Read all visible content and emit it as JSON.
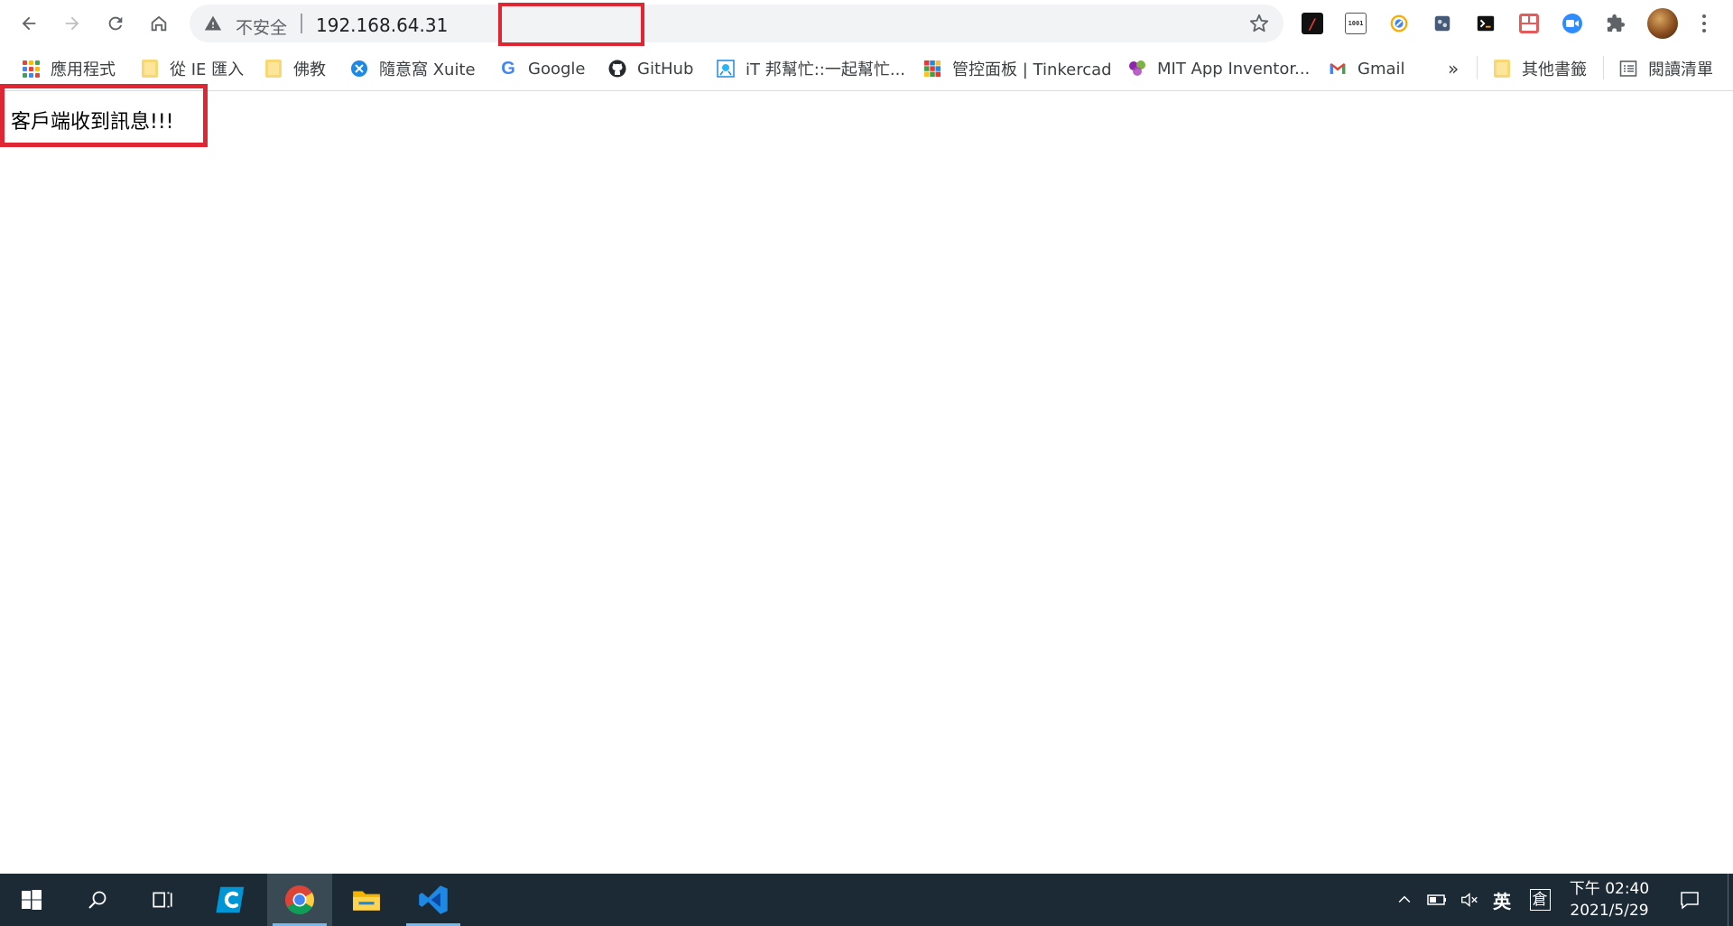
{
  "browser": {
    "address_bar": {
      "security_label": "不安全",
      "url": "192.168.64.31"
    },
    "icons": {
      "back": "arrow-left-icon",
      "forward": "arrow-right-icon",
      "reload": "reload-icon",
      "home": "home-icon",
      "warning": "warning-triangle-icon",
      "star": "star-icon"
    },
    "bookmarks": [
      {
        "label": "應用程式",
        "icon": "apps-icon"
      },
      {
        "label": "從 IE 匯入",
        "icon": "folder-icon"
      },
      {
        "label": "佛教",
        "icon": "folder-icon"
      },
      {
        "label": "隨意窩 Xuite",
        "icon": "xuite-icon"
      },
      {
        "label": "Google",
        "icon": "google-icon"
      },
      {
        "label": "GitHub",
        "icon": "github-icon"
      },
      {
        "label": "iT 邦幫忙::一起幫忙...",
        "icon": "ithome-icon"
      },
      {
        "label": "管控面板 | Tinkercad",
        "icon": "tinkercad-icon"
      },
      {
        "label": "MIT App Inventor...",
        "icon": "app-inventor-icon"
      },
      {
        "label": "Gmail",
        "icon": "gmail-icon"
      }
    ],
    "overflow_label": "»",
    "other_bookmarks": "其他書籤",
    "reading_list": "閱讀清單",
    "extension_labels": {
      "hex": "1001"
    }
  },
  "page": {
    "message": "客戶端收到訊息!!!"
  },
  "taskbar": {
    "tray": {
      "ime_label": "英",
      "ime_mode": "倉"
    },
    "clock": {
      "time": "下午 02:40",
      "date": "2021/5/29"
    }
  },
  "colors": {
    "highlight": "#e02533",
    "taskbar": "#1b2a34",
    "toolbar_bg": "#ffffff",
    "omnibox_bg": "#f1f3f4"
  }
}
